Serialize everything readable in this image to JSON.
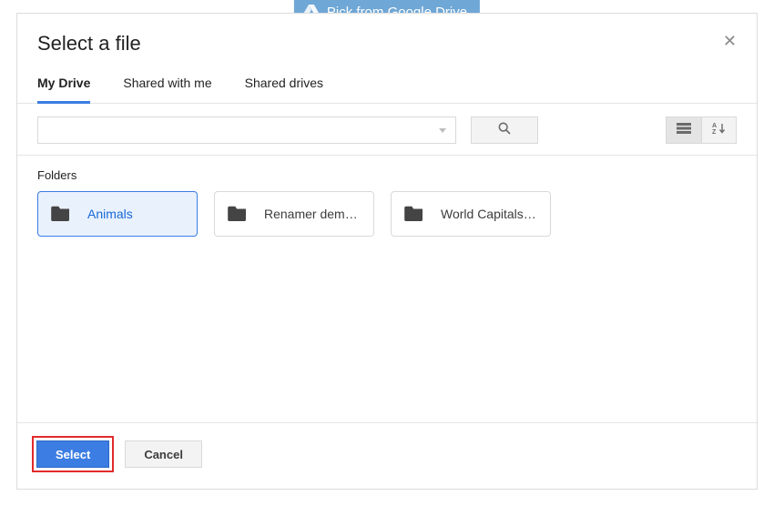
{
  "topButton": {
    "label": "Pick from Google Drive"
  },
  "dialog": {
    "title": "Select a file",
    "tabs": [
      {
        "label": "My Drive",
        "active": true
      },
      {
        "label": "Shared with me",
        "active": false
      },
      {
        "label": "Shared drives",
        "active": false
      }
    ],
    "search": {
      "value": ""
    },
    "section_label": "Folders",
    "folders": [
      {
        "label": "Animals",
        "selected": true
      },
      {
        "label": "Renamer dem…",
        "selected": false
      },
      {
        "label": "World Capitals…",
        "selected": false
      }
    ],
    "actions": {
      "select_label": "Select",
      "cancel_label": "Cancel"
    }
  }
}
